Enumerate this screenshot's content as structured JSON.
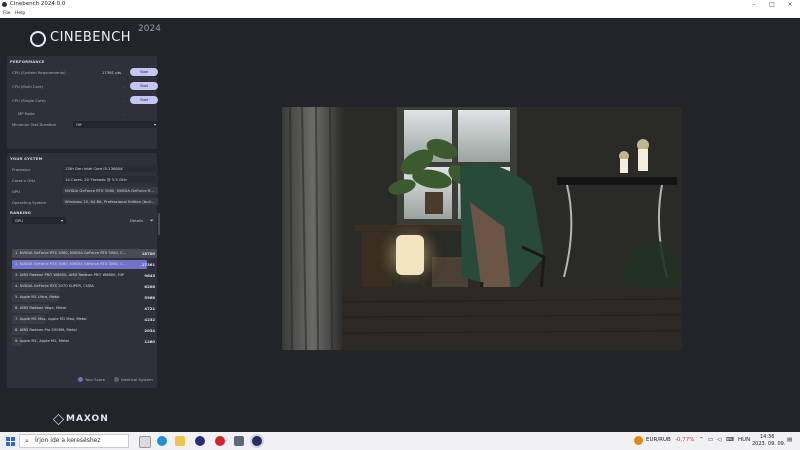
{
  "window": {
    "title": "Cinebench 2024.0.0",
    "min": "–",
    "max": "□",
    "close": "×"
  },
  "menu": [
    "File",
    "Help"
  ],
  "logo": {
    "brand": "CINEBENCH",
    "year": "2024"
  },
  "performance": {
    "header": "PERFORMANCE",
    "rows": [
      {
        "label": "CPU (System Requirements)",
        "score": "17361 pts",
        "button": "Start"
      },
      {
        "label": "CPU (Multi Core)",
        "score": "-",
        "button": "Start"
      },
      {
        "label": "CPU (Single Core)",
        "score": "-",
        "button": "Start"
      }
    ],
    "mp_ratio_label": "MP Ratio",
    "mp_ratio_value": "-",
    "test_duration_label": "Minimum Test Duration",
    "test_duration_value": "Off"
  },
  "system": {
    "header": "YOUR SYSTEM",
    "rows": [
      {
        "label": "Processor",
        "value": "13th Gen Intel Core i5-13600K"
      },
      {
        "label": "Cores x GHz",
        "value": "14 Cores, 20 Threads @ 3.5 GHz"
      },
      {
        "label": "GPU",
        "value": "NVIDIA GeForce RTX 3060, NVIDIA GeForce R..."
      },
      {
        "label": "Operating System",
        "value": "Windows 10, 64 Bit, Professional Edition (buil..."
      },
      {
        "label": "Info",
        "value": ""
      }
    ]
  },
  "ranking": {
    "header": "RANKING",
    "dropdown": "GPU",
    "details": "Details",
    "max_score": 18700,
    "rows": [
      {
        "name": "1. NVIDIA GeForce RTX 3080, NVIDIA GeForce RTX 3080, C...",
        "score": "18700",
        "value": 18700,
        "type": "ref"
      },
      {
        "name": "2. NVIDIA GeForce RTX 3060, NVIDIA GeForce RTX 3060, C...",
        "score": "17361",
        "value": 17361,
        "type": "you"
      },
      {
        "name": "3. AMD Radeon PRO W6800, AMD Radeon PRO W6800, HIP",
        "score": "9643",
        "value": 9643,
        "type": "ref"
      },
      {
        "name": "4. NVIDIA GeForce RTX 2070 SUPER, CUDA",
        "score": "6206",
        "value": 6206,
        "type": "ref"
      },
      {
        "name": "5. Apple M1 Ultra, Metal",
        "score": "5968",
        "value": 5968,
        "type": "ref"
      },
      {
        "name": "6. AMD Radeon Vega, Metal",
        "score": "4721",
        "value": 4721,
        "type": "ref"
      },
      {
        "name": "7. Apple M1 Max, Apple M1 Max, Metal",
        "score": "4232",
        "value": 4232,
        "type": "ref"
      },
      {
        "name": "8. AMD Radeon Pro 5500M, Metal",
        "score": "2034",
        "value": 2034,
        "type": "ref"
      },
      {
        "name": "9. Apple M1, Apple M1, Metal",
        "score": "1260",
        "value": 1260,
        "type": "ref"
      }
    ],
    "legend_you": "Your Score",
    "legend_ref": "Identical System"
  },
  "maxon": "MAXON",
  "colors": {
    "accent": "#7173c9",
    "button": "#c4c6f2",
    "panel": "#2f3038",
    "background": "#23242a"
  },
  "taskbar": {
    "search_placeholder": "Írjon ide a kereséshez",
    "icons": [
      "start-icon",
      "task-view-icon",
      "edge-icon",
      "file-explorer-icon",
      "firefox-icon",
      "opera-icon",
      "store-icon",
      "cinebench-icon"
    ],
    "currency": "EUR/RUB",
    "change": "-0,77%",
    "lang": "HUN",
    "time": "14:36",
    "date": "2023. 09. 09."
  }
}
